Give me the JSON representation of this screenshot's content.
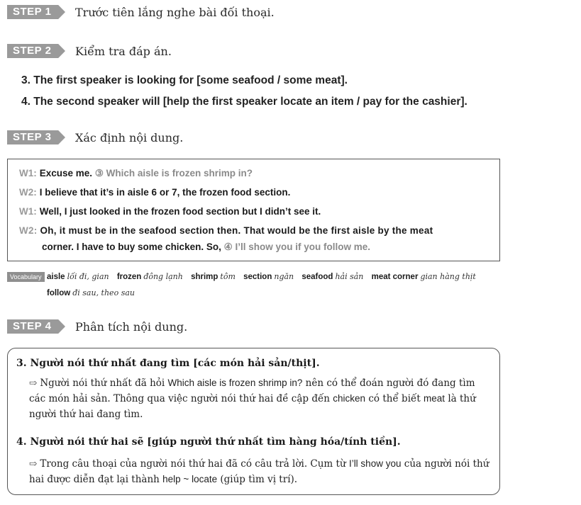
{
  "steps": [
    {
      "badge": "STEP 1",
      "text": "Trước tiên lắng nghe bài đối thoại."
    },
    {
      "badge": "STEP 2",
      "text": "Kiểm tra đáp án."
    },
    {
      "badge": "STEP 3",
      "text": "Xác định nội dung."
    },
    {
      "badge": "STEP 4",
      "text": "Phân tích nội dung."
    }
  ],
  "questions": [
    "3. The first speaker is looking for [some seafood / some meat].",
    "4. The second speaker will [help the first speaker locate an item / pay for the cashier]."
  ],
  "dialog": {
    "l1_spk": "W1:",
    "l1_a": "Excuse me.",
    "l1_b": "③ Which aisle is frozen shrimp in?",
    "l2_spk": "W2:",
    "l2_a": "I believe that it’s in aisle 6 or 7, the frozen food section.",
    "l3_spk": "W1:",
    "l3_a": "Well, I just looked in the frozen food section but I didn’t see it.",
    "l4_spk": "W2:",
    "l4_a": "Oh, it must be in the seafood section then. That would be the first aisle by the meat",
    "l5_a": "corner. I have to buy some chicken. So,",
    "l5_b": "④ I’ll show you if you follow me."
  },
  "vocabulary": {
    "tag": "Vocabulary",
    "items": [
      {
        "w": "aisle",
        "m": "lối đi, gian"
      },
      {
        "w": "frozen",
        "m": "đông lạnh"
      },
      {
        "w": "shrimp",
        "m": "tôm"
      },
      {
        "w": "section",
        "m": "ngăn"
      },
      {
        "w": "seafood",
        "m": "hải sản"
      },
      {
        "w": "meat corner",
        "m": "gian hàng thịt"
      },
      {
        "w": "follow",
        "m": "đi sau, theo sau"
      }
    ]
  },
  "analysis": {
    "q3_head": "3.  Người nói thứ nhất đang tìm [các món hải sản/thịt].",
    "q3_body_1": "Người nói thứ nhất đã hỏi ",
    "q3_body_en1": "Which aisle is frozen shrimp in?",
    "q3_body_2": " nên có thể đoán người đó đang tìm các món hải sản. Thông qua việc người nói thứ hai đề cập đến ",
    "q3_body_en2": "chicken",
    "q3_body_3": " có thể biết ",
    "q3_body_en3": "meat",
    "q3_body_4": " là thứ người thứ hai đang tìm.",
    "q4_head": "4.  Người nói thứ hai sẽ [giúp người thứ nhất tìm hàng hóa/tính tiền].",
    "q4_body_1": "Trong câu thoại của người nói thứ hai đã có câu trả lời. Cụm từ ",
    "q4_body_en1": "I’ll show you",
    "q4_body_2": " của người nói thứ hai được diễn đạt lại thành ",
    "q4_body_en2": "help ~ locate",
    "q4_body_3": " (giúp tìm vị trí)."
  }
}
